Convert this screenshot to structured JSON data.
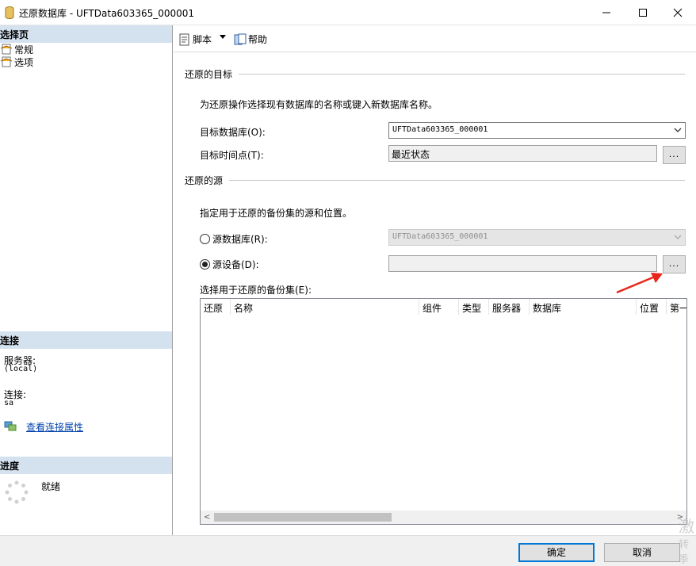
{
  "window": {
    "title": "还原数据库 - UFTData603365_000001"
  },
  "left_pane": {
    "select_page_header": "选择页",
    "pages": [
      {
        "label": "常规",
        "icon": "page-icon"
      },
      {
        "label": "选项",
        "icon": "page-icon"
      }
    ],
    "connection": {
      "header": "连接",
      "server_label": "服务器:",
      "server_value": "(local)",
      "connection_label": "连接:",
      "connection_value": "sa",
      "link": "查看连接属性"
    },
    "progress": {
      "header": "进度",
      "status": "就绪"
    }
  },
  "toolbar": {
    "script_label": "脚本",
    "help_label": "帮助"
  },
  "restore_target": {
    "section_title": "还原的目标",
    "description": "为还原操作选择现有数据库的名称或键入新数据库名称。",
    "target_db_label": "目标数据库(O):",
    "target_db_value": "UFTData603365_000001",
    "target_time_label": "目标时间点(T):",
    "target_time_value": "最近状态",
    "dots": "..."
  },
  "restore_source": {
    "section_title": "还原的源",
    "description": "指定用于还原的备份集的源和位置。",
    "source_db_label": "源数据库(R):",
    "source_db_value": "UFTData603365_000001",
    "source_device_label": "源设备(D):",
    "source_device_value": "",
    "selected_option": "源设备",
    "dots": "..."
  },
  "backup_sets": {
    "label": "选择用于还原的备份集(E):",
    "columns": [
      "还原",
      "名称",
      "组件",
      "类型",
      "服务器",
      "数据库",
      "位置",
      "第一"
    ]
  },
  "buttons": {
    "ok": "确定",
    "cancel": "取消"
  },
  "watermark": {
    "line1": "激",
    "line2": "转季"
  },
  "colors": {
    "pane_header_bg": "#d4e1ee",
    "accent": "#0078d7",
    "annotation_arrow": "#e8251b",
    "link": "#0645ad"
  }
}
